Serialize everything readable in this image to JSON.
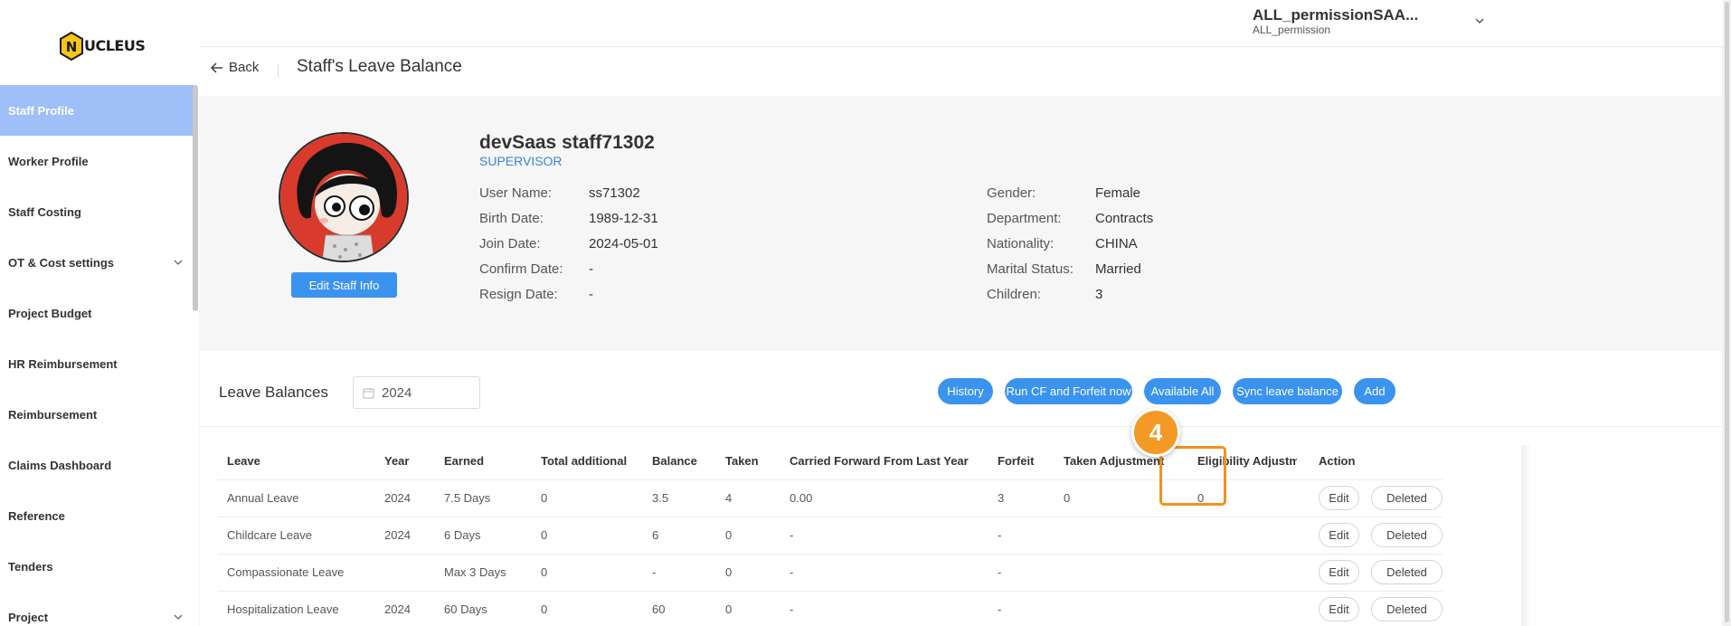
{
  "app": {
    "logo_text": "UCLEUS",
    "logo_letter": "N"
  },
  "sidebar": {
    "items": [
      {
        "label": "Staff Profile",
        "active": true,
        "expandable": false
      },
      {
        "label": "Worker Profile",
        "active": false,
        "expandable": false
      },
      {
        "label": "Staff Costing",
        "active": false,
        "expandable": false
      },
      {
        "label": "OT & Cost settings",
        "active": false,
        "expandable": true
      },
      {
        "label": "Project Budget",
        "active": false,
        "expandable": false
      },
      {
        "label": "HR Reimbursement",
        "active": false,
        "expandable": false
      },
      {
        "label": "Reimbursement",
        "active": false,
        "expandable": false
      },
      {
        "label": "Claims Dashboard",
        "active": false,
        "expandable": false
      },
      {
        "label": "Reference",
        "active": false,
        "expandable": false
      },
      {
        "label": "Tenders",
        "active": false,
        "expandable": false
      },
      {
        "label": "Project",
        "active": false,
        "expandable": true
      }
    ]
  },
  "topbar": {
    "user_name": "ALL_permissionSAA...",
    "user_role": "ALL_permission"
  },
  "header": {
    "back_label": "Back",
    "title": "Staff's Leave Balance"
  },
  "profile": {
    "name": "devSaas staff71302",
    "role": "SUPERVISOR",
    "edit_button": "Edit Staff Info",
    "left": [
      {
        "label": "User Name:",
        "value": "ss71302"
      },
      {
        "label": "Birth Date:",
        "value": "1989-12-31"
      },
      {
        "label": "Join Date:",
        "value": "2024-05-01"
      },
      {
        "label": "Confirm Date:",
        "value": "-"
      },
      {
        "label": "Resign Date:",
        "value": "-"
      }
    ],
    "right": [
      {
        "label": "Gender:",
        "value": "Female"
      },
      {
        "label": "Department:",
        "value": "Contracts"
      },
      {
        "label": "Nationality:",
        "value": "CHINA"
      },
      {
        "label": "Marital Status:",
        "value": "Married"
      },
      {
        "label": "Children:",
        "value": "3"
      }
    ]
  },
  "leave": {
    "title": "Leave Balances",
    "year": "2024",
    "buttons": {
      "history": "History",
      "run_cf": "Run CF and Forfeit now",
      "available_all": "Available All",
      "sync": "Sync leave balance",
      "add": "Add"
    },
    "columns": [
      "Leave",
      "Year",
      "Earned",
      "Total additional",
      "Balance",
      "Taken",
      "Carried Forward From Last Year",
      "Forfeit",
      "Taken Adjustment",
      "Eligibility Adjustm",
      "Action"
    ],
    "rows": [
      {
        "leave": "Annual Leave",
        "year": "2024",
        "earned": "7.5 Days",
        "total_additional": "0",
        "balance": "3.5",
        "taken": "4",
        "carried": "0.00",
        "forfeit": "3",
        "taken_adj": "0",
        "elig_adj": "0"
      },
      {
        "leave": "Childcare Leave",
        "year": "2024",
        "earned": "6 Days",
        "total_additional": "0",
        "balance": "6",
        "taken": "0",
        "carried": "-",
        "forfeit": "-",
        "taken_adj": "",
        "elig_adj": ""
      },
      {
        "leave": "Compassionate Leave",
        "year": "",
        "earned": "Max 3 Days",
        "total_additional": "0",
        "balance": "-",
        "taken": "0",
        "carried": "-",
        "forfeit": "-",
        "taken_adj": "",
        "elig_adj": ""
      },
      {
        "leave": "Hospitalization Leave",
        "year": "2024",
        "earned": "60 Days",
        "total_additional": "0",
        "balance": "60",
        "taken": "0",
        "carried": "-",
        "forfeit": "-",
        "taken_adj": "",
        "elig_adj": ""
      }
    ],
    "edit_label": "Edit",
    "deleted_label": "Deleted"
  },
  "annotation": {
    "step_number": "4",
    "color": "#f39a26"
  }
}
